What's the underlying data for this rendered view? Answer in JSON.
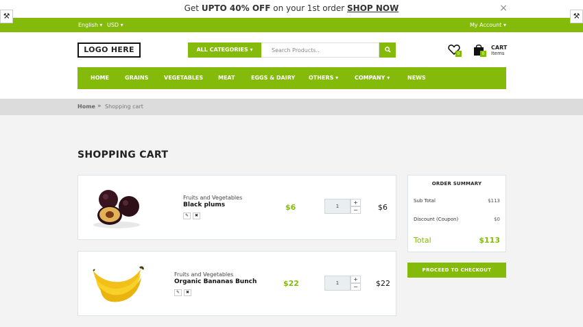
{
  "promo": {
    "pre": "Get ",
    "bold": "UPTO 40% OFF",
    "mid": " on your 1st order ",
    "link": "SHOP NOW",
    "close": "×"
  },
  "topbar": {
    "language": "English ▾",
    "currency": "USD ▾",
    "account": "My Account ▾"
  },
  "header": {
    "logo": "LOGO HERE",
    "category_button": "ALL CATEGORIES ▾",
    "search_placeholder": "Search Products..",
    "wishlist_count": "0",
    "cart_count": "0",
    "cart_label": "CART",
    "cart_sub": "Items"
  },
  "nav": [
    {
      "label": "HOME"
    },
    {
      "label": "GRAINS"
    },
    {
      "label": "VEGETABLES"
    },
    {
      "label": "MEAT"
    },
    {
      "label": "EGGS & DAIRY"
    },
    {
      "label": "OTHERS ▾"
    },
    {
      "label": "COMPANY ▾"
    },
    {
      "label": "NEWS"
    }
  ],
  "breadcrumb": {
    "home": "Home",
    "sep": "»",
    "current": "Shopping cart"
  },
  "page_title": "SHOPPING CART",
  "items": [
    {
      "category": "Fruits and Vegetables",
      "name": "Black plums",
      "price": "$6",
      "qty": "1",
      "total": "$6"
    },
    {
      "category": "Fruits and Vegetables",
      "name": "Organic Bananas Bunch",
      "price": "$22",
      "qty": "1",
      "total": "$22"
    }
  ],
  "summary": {
    "title": "ORDER SUMMARY",
    "subtotal_label": "Sub Total",
    "subtotal": "$113",
    "discount_label": "Discount (Coupon)",
    "discount": "$0",
    "total_label": "Total",
    "total": "$113",
    "checkout": "PROCEED TO CHECKOUT"
  },
  "colors": {
    "accent": "#84bb0b",
    "background": "#f3f3f3"
  }
}
